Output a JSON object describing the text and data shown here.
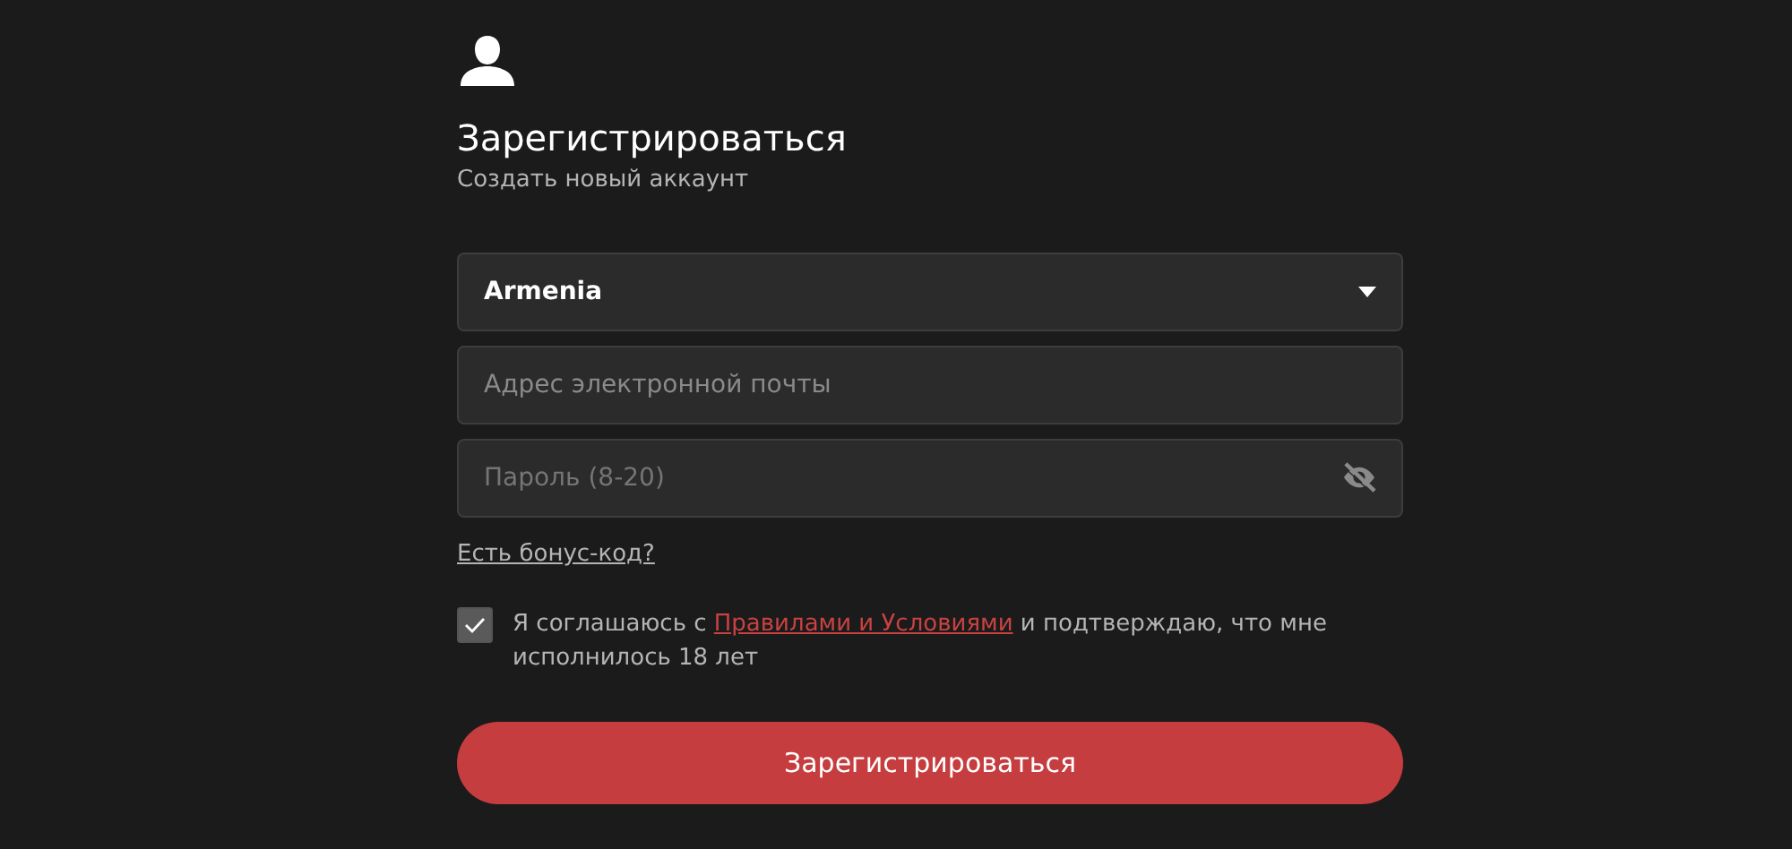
{
  "header": {
    "title": "Зарегистрироваться",
    "subtitle": "Создать новый аккаунт"
  },
  "country": {
    "value": "Armenia"
  },
  "email": {
    "placeholder": "Адрес электронной почты"
  },
  "password": {
    "placeholder": "Пароль (8-20)"
  },
  "bonus_link": "Есть бонус-код?",
  "agreement": {
    "checked": true,
    "text_before": "Я соглашаюсь с ",
    "link": "Правилами и Условиями",
    "text_after": " и подтверждаю, что мне исполнилось 18 лет"
  },
  "submit": "Зарегистрироваться"
}
